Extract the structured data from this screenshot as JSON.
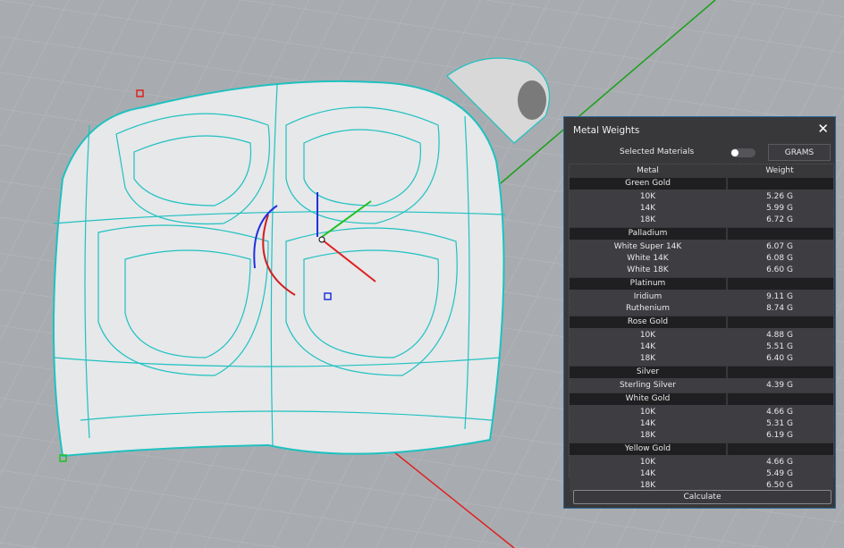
{
  "panel": {
    "title": "Metal Weights",
    "close_icon": "close-icon",
    "selected_materials_label": "Selected Materials",
    "selected_materials_toggle": false,
    "units_button": "GRAMS",
    "columns": [
      "Metal",
      "Weight"
    ],
    "groups": [
      {
        "name": "Green Gold",
        "items": [
          {
            "metal": "10K",
            "weight": "5.26 G"
          },
          {
            "metal": "14K",
            "weight": "5.99 G"
          },
          {
            "metal": "18K",
            "weight": "6.72 G"
          }
        ]
      },
      {
        "name": "Palladium",
        "items": [
          {
            "metal": "White Super 14K",
            "weight": "6.07 G"
          },
          {
            "metal": "White 14K",
            "weight": "6.08 G"
          },
          {
            "metal": "White 18K",
            "weight": "6.60 G"
          }
        ]
      },
      {
        "name": "Platinum",
        "items": [
          {
            "metal": "Iridium",
            "weight": "9.11 G"
          },
          {
            "metal": "Ruthenium",
            "weight": "8.74 G"
          }
        ]
      },
      {
        "name": "Rose Gold",
        "items": [
          {
            "metal": "10K",
            "weight": "4.88 G"
          },
          {
            "metal": "14K",
            "weight": "5.51 G"
          },
          {
            "metal": "18K",
            "weight": "6.40 G"
          }
        ]
      },
      {
        "name": "Silver",
        "items": [
          {
            "metal": "Sterling Silver",
            "weight": "4.39 G"
          }
        ]
      },
      {
        "name": "White Gold",
        "items": [
          {
            "metal": "10K",
            "weight": "4.66 G"
          },
          {
            "metal": "14K",
            "weight": "5.31 G"
          },
          {
            "metal": "18K",
            "weight": "6.19 G"
          }
        ]
      },
      {
        "name": "Yellow Gold",
        "items": [
          {
            "metal": "10K",
            "weight": "4.66 G"
          },
          {
            "metal": "14K",
            "weight": "5.49 G"
          },
          {
            "metal": "18K",
            "weight": "6.50 G"
          }
        ]
      }
    ],
    "calculate_button": "Calculate"
  },
  "colors": {
    "wireframe": "#1fc1c0",
    "panel_bg": "#38383b",
    "viewport_bg": "#a8acb0",
    "x_axis": "#e02020",
    "y_axis": "#1aa01a"
  }
}
